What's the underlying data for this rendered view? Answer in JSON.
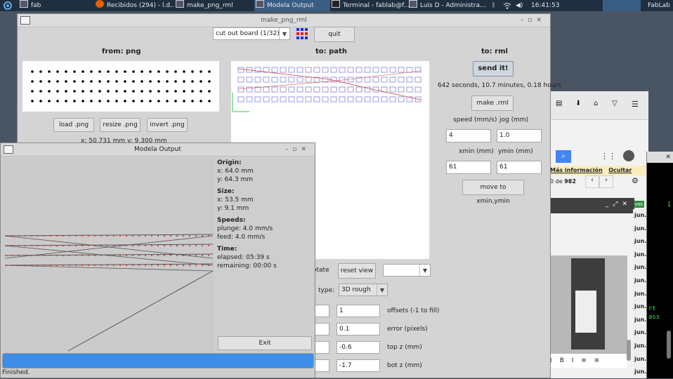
{
  "taskbar": {
    "workspace": "fab",
    "items": [
      {
        "label": "Recibidos (294) - l.d..."
      },
      {
        "label": "make_png_rml"
      },
      {
        "label": "Modela Output"
      },
      {
        "label": "Terminal - fablab@f..."
      },
      {
        "label": "Luis D - Administra..."
      }
    ],
    "clock": "16:41:53",
    "user": "FabLab"
  },
  "main_window": {
    "title": "make_png_rml",
    "process_select": "cut out board (1/32)",
    "quit_label": "quit",
    "from_png": {
      "heading": "from: png",
      "load_label": "load .png",
      "resize_label": "resize .png",
      "invert_label": "invert .png",
      "size_text": "x: 50.731 mm  y: 9.300 mm"
    },
    "to_path": {
      "heading": "to: path",
      "rotate_label": "otate",
      "reset_view_label": "reset view",
      "type_label": "type:",
      "type_value": "3D rough",
      "params": [
        {
          "label": "offsets (-1 to fill)",
          "value": "1"
        },
        {
          "label": "error (pixels)",
          "value": "0.1"
        },
        {
          "label": "top z (mm)",
          "value": "-0.6"
        },
        {
          "label": "bot z (mm)",
          "value": "-1.7"
        }
      ]
    },
    "to_rml": {
      "heading": "to: rml",
      "send_label": "send it!",
      "time_text": "642 seconds, 10.7 minutes, 0.18 hours",
      "make_label": "make .rml",
      "speed_label": "speed (mm/s)",
      "jog_label": "jog (mm)",
      "speed_value": "4",
      "jog_value": "1.0",
      "xmin_label": "xmin (mm)",
      "ymin_label": "ymin (mm)",
      "xmin_value": "61",
      "ymin_value": "61",
      "move_label": "move to xmin,ymin"
    }
  },
  "modela_window": {
    "title": "Modela Output",
    "origin_heading": "Origin:",
    "origin_x": "x: 64.0 mm",
    "origin_y": "y: 64.3 mm",
    "size_heading": "Size:",
    "size_x": "x: 53.5 mm",
    "size_y": "y: 9.1 mm",
    "speeds_heading": "Speeds:",
    "plunge": "plunge: 4.0 mm/s",
    "feed": "feed: 4.0 mm/s",
    "time_heading": "Time:",
    "elapsed": "elapsed: 05:39 s",
    "remaining": "remaining: 00:00 s",
    "exit_label": "Exit",
    "progress": 1.0,
    "status": "Finished."
  },
  "browser_fragment": {
    "more_info": "Más información",
    "hide": "Ocultar",
    "page_count_prefix": "0 de",
    "page_count": "982",
    "date_label": "jun.",
    "badge": "vos"
  },
  "terminal_fragment": {
    "lines": [
      "1",
      "rt",
      "ass"
    ]
  },
  "colors": {
    "taskbar_bg": "#1f2f40",
    "active_task": "#3a5d84",
    "progress_fill": "#3d8ee8",
    "toolpath": "#9a9ae0",
    "toolpath_red": "#d04040"
  }
}
